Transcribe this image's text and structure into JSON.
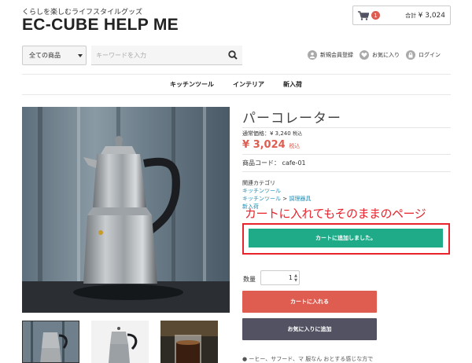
{
  "header": {
    "tagline": "くらしを楽しむライフスタイルグッズ",
    "logo": "EC-CUBE HELP ME",
    "cart": {
      "count": "1",
      "total_label": "合計",
      "total": "¥ 3,024"
    }
  },
  "search": {
    "category": "全ての商品",
    "placeholder": "キーワードを入力"
  },
  "user_links": [
    "新規会員登録",
    "お気に入り",
    "ログイン"
  ],
  "gnav": [
    "キッチンツール",
    "インテリア",
    "新入荷"
  ],
  "product": {
    "name": "パーコレーター",
    "normal_price_label": "通常価格：¥ 3,240",
    "normal_price_tax": "税込",
    "price": "¥ 3,024",
    "price_tax": "税込",
    "code": "商品コード： cafe-01",
    "related_label": "関連カテゴリ",
    "cat1": "キッチンツール",
    "cat2a": "キッチンツール",
    "cat_sep": ">",
    "cat2b": "調理器具",
    "cat3": "新入荷",
    "added_button": "カートに追加しました。",
    "qty_label": "数量",
    "qty": "1",
    "cart_button": "カートに入れる",
    "fav_button": "お気に入りに追加",
    "desc": "● ーヒー、サフード、マ 服なん おとする感じな方で"
  },
  "annotation": {
    "text": "カートに入れてもそのままのページ",
    "color": "#e8232c"
  },
  "colors": {
    "accent_green": "#1faa88",
    "accent_red": "#de5d50",
    "dark_button": "#525263",
    "link_blue": "#1f8fb8"
  }
}
